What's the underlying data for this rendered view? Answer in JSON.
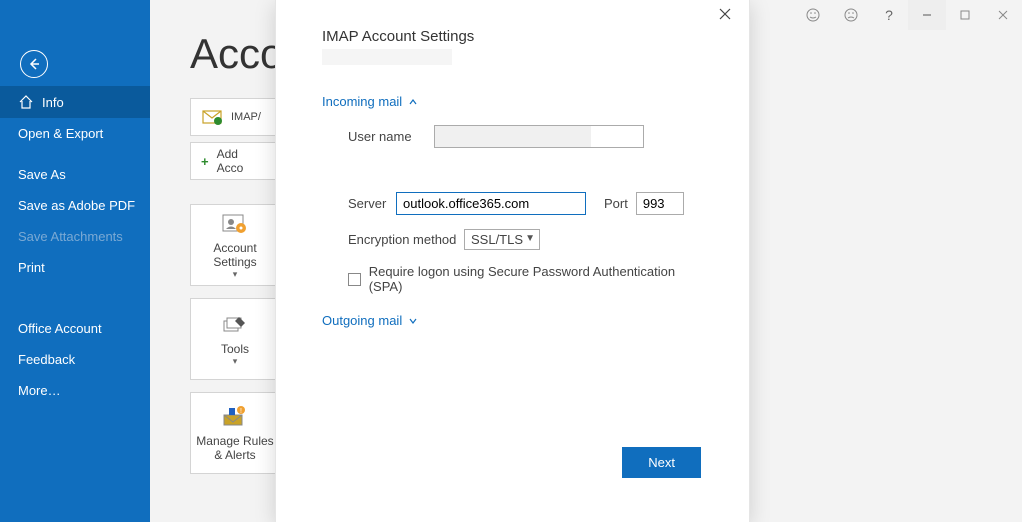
{
  "sidebar": {
    "items": [
      {
        "label": "Info",
        "active": true,
        "has_icon": true
      },
      {
        "label": "Open & Export"
      },
      {
        "label": "Save As"
      },
      {
        "label": "Save as Adobe PDF"
      },
      {
        "label": "Save Attachments",
        "disabled": true
      },
      {
        "label": "Print"
      },
      {
        "label": "Office Account",
        "group": "bottom"
      },
      {
        "label": "Feedback",
        "group": "bottom"
      },
      {
        "label": "More…",
        "group": "bottom"
      }
    ]
  },
  "main": {
    "title_visible": "Acco",
    "account_label": "IMAP/",
    "add_account_label": "Add Acco",
    "tiles": [
      {
        "label": "Account Settings",
        "caret": true
      },
      {
        "label": "Tools",
        "caret": true
      },
      {
        "label": "Manage Rules & Alerts"
      }
    ]
  },
  "dialog": {
    "title": "IMAP Account Settings",
    "incoming_label": "Incoming mail",
    "incoming_expanded": true,
    "username_label": "User name",
    "username_value": "",
    "server_label": "Server",
    "server_value": "outlook.office365.com",
    "port_label": "Port",
    "port_value": "993",
    "encryption_label": "Encryption method",
    "encryption_value": "SSL/TLS",
    "spa_label": "Require logon using Secure Password Authentication (SPA)",
    "spa_checked": false,
    "outgoing_label": "Outgoing mail",
    "outgoing_expanded": false,
    "next_label": "Next"
  }
}
